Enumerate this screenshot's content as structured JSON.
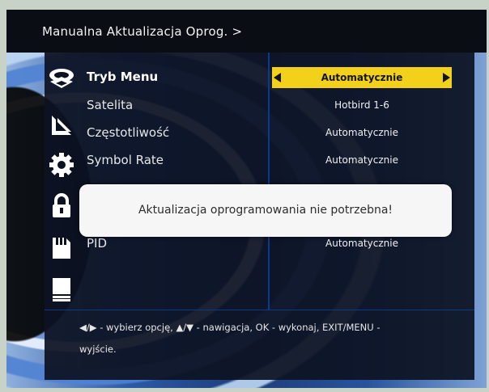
{
  "header": {
    "title": "Manualna Aktualizacja Oprog. >"
  },
  "sidebar_icons": [
    "satellite-dish-icon",
    "antenna-icon",
    "gear-icon",
    "lock-icon",
    "memory-card-icon",
    "receiver-icon"
  ],
  "menu": {
    "items": [
      {
        "label": "Tryb Menu",
        "value": "Automatycznie",
        "selected": true
      },
      {
        "label": "Satelita",
        "value": "Hotbird 1-6"
      },
      {
        "label": "Częstotliwość",
        "value": "Automatycznie"
      },
      {
        "label": "Symbol Rate",
        "value": "Automatycznie"
      },
      {
        "label": "PID",
        "value": "Automatycznie"
      }
    ]
  },
  "dialog": {
    "message": "Aktualizacja oprogramowania nie potrzebna!"
  },
  "footer": {
    "hint_line1": "◀/▶ - wybierz opcję, ▲/▼ - nawigacja, OK - wykonaj, EXIT/MENU -",
    "hint_line2": "wyjście."
  },
  "colors": {
    "highlight": "#f3d11b",
    "panel": "#0d1222",
    "divider": "#0a3a8c",
    "dialog_bg": "#f6f6f6"
  }
}
